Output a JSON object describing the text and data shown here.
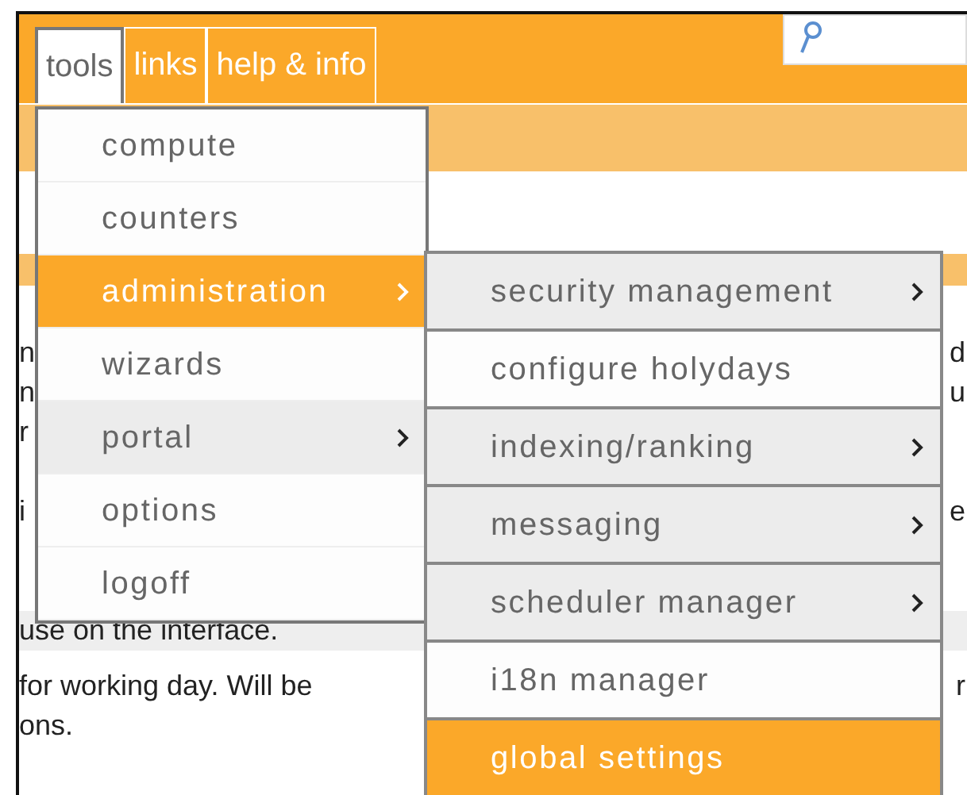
{
  "tabs": [
    {
      "label": "tools",
      "selected": true
    },
    {
      "label": "links",
      "selected": false
    },
    {
      "label": "help & info",
      "selected": false
    }
  ],
  "background_rows": [
    {
      "left": "n",
      "right": "d"
    },
    {
      "left": "n",
      "right": "u"
    },
    {
      "left": "r"
    },
    {
      "left": "i",
      "right": "e"
    },
    {
      "left": "use on the interface."
    },
    {
      "left": "for working day. Will be",
      "right": "r"
    },
    {
      "left": "ons."
    }
  ],
  "tools_menu": [
    {
      "label": "compute",
      "has_submenu": false,
      "selected": false
    },
    {
      "label": "counters",
      "has_submenu": false,
      "selected": false
    },
    {
      "label": "administration",
      "has_submenu": true,
      "selected": true
    },
    {
      "label": "wizards",
      "has_submenu": false,
      "selected": false
    },
    {
      "label": "portal",
      "has_submenu": true,
      "selected": false
    },
    {
      "label": "options",
      "has_submenu": false,
      "selected": false
    },
    {
      "label": "logoff",
      "has_submenu": false,
      "selected": false
    }
  ],
  "administration_submenu": [
    {
      "label": "security management",
      "has_submenu": true,
      "selected": false
    },
    {
      "label": "configure holydays",
      "has_submenu": false,
      "selected": false
    },
    {
      "label": "indexing/ranking",
      "has_submenu": true,
      "selected": false
    },
    {
      "label": "messaging",
      "has_submenu": true,
      "selected": false
    },
    {
      "label": "scheduler manager",
      "has_submenu": true,
      "selected": false
    },
    {
      "label": "i18n manager",
      "has_submenu": false,
      "selected": false
    },
    {
      "label": "global settings",
      "has_submenu": false,
      "selected": true
    }
  ]
}
